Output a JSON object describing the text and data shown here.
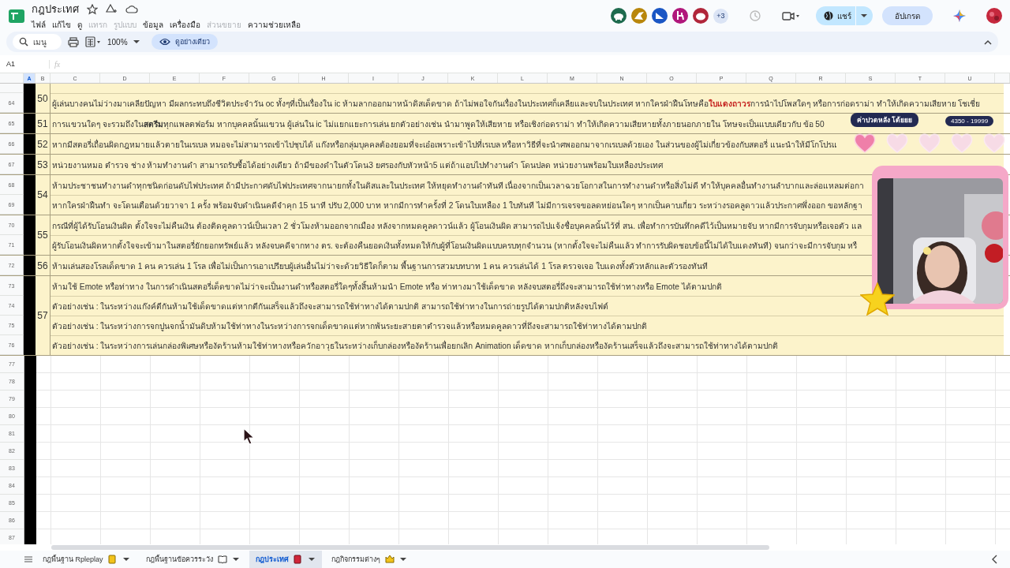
{
  "document": {
    "title": "กฎประเทศ"
  },
  "menu": [
    {
      "label": "ไฟล์",
      "disabled": false
    },
    {
      "label": "แก้ไข",
      "disabled": false
    },
    {
      "label": "ดู",
      "disabled": false
    },
    {
      "label": "แทรก",
      "disabled": true
    },
    {
      "label": "รูปแบบ",
      "disabled": true
    },
    {
      "label": "ข้อมูล",
      "disabled": false
    },
    {
      "label": "เครื่องมือ",
      "disabled": false
    },
    {
      "label": "ส่วนขยาย",
      "disabled": true
    },
    {
      "label": "ความช่วยเหลือ",
      "disabled": false
    }
  ],
  "collaborators": [
    {
      "color": "#1e6b4e"
    },
    {
      "color": "#b8860b"
    },
    {
      "color": "#1a56c4"
    },
    {
      "color": "#b0177b"
    },
    {
      "color": "#b0263a"
    }
  ],
  "collaborators_more": "+3",
  "share_button": "แชร์",
  "upgrade_button": "อัปเกรด",
  "toolbar": {
    "search": {
      "placeholder": "เมนู"
    },
    "zoom": "100%",
    "view_mode_button": "ดูอย่างเดียว"
  },
  "formula_bar": {
    "cell_ref": "A1",
    "function_label": "fx"
  },
  "columns": [
    {
      "label": "A",
      "selected": true
    },
    {
      "label": "B",
      "selected": false
    },
    {
      "label": "C",
      "selected": false
    },
    {
      "label": "D",
      "selected": false
    },
    {
      "label": "E",
      "selected": false
    },
    {
      "label": "F",
      "selected": false
    },
    {
      "label": "G",
      "selected": false
    },
    {
      "label": "H",
      "selected": false
    },
    {
      "label": "I",
      "selected": false
    },
    {
      "label": "J",
      "selected": false
    },
    {
      "label": "K",
      "selected": false
    },
    {
      "label": "L",
      "selected": false
    },
    {
      "label": "M",
      "selected": false
    },
    {
      "label": "N",
      "selected": false
    },
    {
      "label": "O",
      "selected": false
    },
    {
      "label": "P",
      "selected": false
    },
    {
      "label": "Q",
      "selected": false
    },
    {
      "label": "R",
      "selected": false
    },
    {
      "label": "S",
      "selected": false
    },
    {
      "label": "T",
      "selected": false
    },
    {
      "label": "U",
      "selected": false
    }
  ],
  "rules": [
    {
      "number": "50",
      "cut_top": true,
      "lines": [
        {
          "row": "64",
          "color": "#c5221f",
          "text": "ผู้เล่นบางคนไม่ว่างมาเคลียปัญหา มีผลกระทบถึงชีวิตประจำวัน oc ทั้งๆที่เป็นเรื่องใน ic  ห้ามลากออกมาหน้าดิสเด็ดขาด ถ้าไม่พอใจกันเรื่องในประเทศก็เคลียและจบในประเทศ หากใครฝ่าฝืนโทษคือ **ใบแดงถาวร** การนำไปโพสใดๆ หรือการก่อดราม่า ทำให้เกิดความเสียหาย โชเชี่ย"
        }
      ]
    },
    {
      "number": "51",
      "lines": [
        {
          "row": "65",
          "text": "การแขวนใดๆ จะรวมถึงใน**สตรีม**ทุกแพลตฟอร์ม หากบุคคลนั้นแขวน ผู้เล่นใน ic ไม่แยกแยะการเล่น ยกตัวอย่างเช่น นำมาพูดให้เสียหาย หรือเชิงก่อดราม่า ทำให้เกิดความเสียหายทั้งภายนอกภายใน โทษจะเป็นแบบเดียวกับ ข้อ 50"
        }
      ]
    },
    {
      "number": "52",
      "lines": [
        {
          "row": "66",
          "text": "หากมีสตอรี่เถื่อนผิดกฎหมายแล้วตายในเรเบล หมอจะไม่สามารถเข้าไปชุบได้ แก๊งหรือกลุ่มบุคคลต้องยอมที่จะเอ๋อเพราะเข้าไปที่เรเบล หรือหาวิธีที่จะนำศพออกมาจากเรเบลด้วยเอง ในส่วนของผู้ไม่เกี่ยวข้องกับสตอรี่ แนะนำให้มีโกโปรแ"
        }
      ]
    },
    {
      "number": "53",
      "lines": [
        {
          "row": "67",
          "text": "หน่วยงานหมอ ตำรวจ ช่าง ห้ามทำงานดำ สามารถรับซื้อได้อย่างเดียว ถ้ามีของดำในตัวโดน3 ยศรองกับหัวหน้า5 แต่ถ้าแอบไปทำงานดำ โดนปลด หน่วยงานพร้อมใบเหลืองประเทศ"
        }
      ]
    },
    {
      "number": "54",
      "lines": [
        {
          "row": "68",
          "text": "ห้ามประชาชนทำงานดำทุกชนิดก่อนดับไฟประเทศ ถ้ามีประกาศดับไฟประเทศจากนายกทั้งในดิสและในประเทศ ให้หยุดทำงานดำทันที เนื่องจากเป็นเวลาฉวยโอกาสในการทำงานดำหรือสิ่งไม่ดี ทำให้บุคคลอื่นทำงานลำบากและล่อแหลมต่อกา"
        },
        {
          "row": "69",
          "text": "หากใครฝ่าฝืนทำ จะโดนเตือนด้วยวาจา 1 ครั้ง พร้อมจับดำเนินคดีจำคุก 15 นาที ปรับ 2,000 บาท หากมีการทำครั้งที่ 2 โดนใบเหลือง 1 ใบทันที ไม่มีการเจรจขอลดหย่อนใดๆ หากเป็นคาบเกี่ยว ระหว่างรอคลูดาวแล้วประกาศพึ่งออก ขอหลักฐา"
        }
      ]
    },
    {
      "number": "55",
      "lines": [
        {
          "row": "70",
          "text": "กรณีที่ผู้ได้รับโอนเงินผิด ตั้งใจจะไม่คืนเงิน ต้องติดคูลดาวน์เป็นเวลา 2 ชั่วโมงห้ามออกจากเมือง หลังจากหมดคูลดาวน์แล้ว ผู้โอนเงินผิด สามารถไปแจ้งชื่อบุคคลนั้นไว้ที่ สน. เพื่อทำการบันทึกคดีไว้เป็นหมายจับ หากมีการจับกุมหรือเจอตัว แล"
        },
        {
          "row": "71",
          "text": "ผู้รับโอนเงินผิดหากตั้งใจจะเข้ามาในสตอรี่ยักยอกทรัพย์แล้ว หลังจบคดีจากทาง ตร. จะต้องคืนยอดเงินทั้งหมดให้กับผู้ที่โอนเงินผิดแบบครบทุกจำนวน (หากตั้งใจจะไม่คืนแล้ว ทำการรับผิดชอบข้อนี้ไม่ได้ใบแดงทันที) จนกว่าจะมีการจับกุม หรื"
        }
      ]
    },
    {
      "number": "56",
      "lines": [
        {
          "row": "72",
          "text": "ห้ามเล่นสองโรลเด็ดขาด 1 คน ควรเล่น 1 โรล เพื่อไม่เป็นการเอาเปรียบผู้เล่นอื่นไม่ว่าจะด้วยวิธีใดก็ตาม พื้นฐานการสวมบทบาท 1 คน ควรเล่นได้ 1 โรล ตรวจเจอ ใบแดงทั้งตัวหลักและตัวรองทันที"
        }
      ]
    },
    {
      "number": "57",
      "lines": [
        {
          "row": "73",
          "text": "ห้ามใช้ Emote หรือท่าทาง ในการดำเนินสตอรี่เด็ดขาดไม่ว่าจะเป็นงานดำหรือสตอรี่ใดๆทั้งสิ้นห้ามนำ Emote หรือ ท่าทางมาใช้เด็ดขาด หลังจบสตอรี่ถึงจะสามารถใช้ท่าทางหรือ Emote ได้ตามปกติ"
        },
        {
          "row": "74",
          "text": "ตัวอย่างเช่น : ในระหว่างแก๊งค์ตีกันห้ามใช้เด็ดขาดแต่หากตีกันเสร็จแล้วถึงจะสามารถใช้ท่าทางได้ตามปกติ สามารถใช้ท่าทางในการถ่ายรูปได้ตามปกติหลังจบไฟต์"
        },
        {
          "row": "75",
          "text": "ตัวอย่างเช่น : ในระหว่างการจกปูนจกน้ำมันดิบห้ามใช้ท่าทางในระหว่างการจกเด็ดขาดแต่หากพ้นระยะสายตาตำรวจแล้วหรือหมดคูลดาวที่ถึงจะสามารถใช้ท่าทางได้ตามปกติ"
        },
        {
          "row": "76",
          "text": "ตัวอย่างเช่น : ในระหว่างการเล่นกล่องพิเศษหรืองัดร้านห้ามใช้ท่าทางหรือควักอาวุธในระหว่างเก็บกล่องหรืองัดร้านเพื่อยกเลิก Animation เด็ดขาด หากเก็บกล่องหรืองัดร้านเสร็จแล้วถึงจะสามารถใช้ท่าทางได้ตามปกติ"
        }
      ]
    }
  ],
  "empty_rows": [
    "77",
    "78",
    "79",
    "80",
    "81",
    "82",
    "83",
    "84",
    "85",
    "86",
    "87"
  ],
  "sheet_tabs": [
    {
      "label": "กฎพื้นฐาน Rpleplay",
      "selected": false
    },
    {
      "label": "กฎพื้นฐานข้อควรระวัง",
      "selected": false
    },
    {
      "label": "กฎประเทศ",
      "selected": true
    },
    {
      "label": "กฎกิจกรรมต่างๆ",
      "selected": false
    }
  ],
  "stream_overlay": {
    "tooltip": "ค่าปวดหลัง โด้ยยย",
    "score": "4350 - 19999",
    "hearts": {
      "stars": 1
    }
  }
}
